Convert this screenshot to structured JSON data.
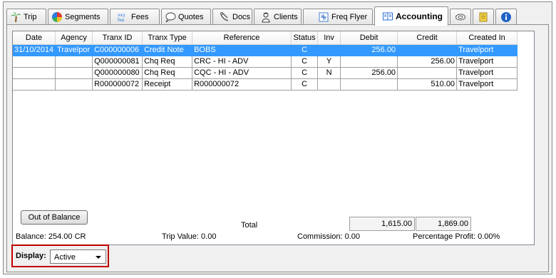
{
  "tabs": [
    {
      "label": "Trip",
      "icon": "palm-tree-icon"
    },
    {
      "label": "Segments",
      "icon": "segments-pie-icon"
    },
    {
      "label": "Fees",
      "icon": "fees-icon"
    },
    {
      "label": "Quotes",
      "icon": "speech-bubble-icon"
    },
    {
      "label": "Docs",
      "icon": "docs-icon"
    },
    {
      "label": "Clients",
      "icon": "clients-icon"
    },
    {
      "label": "Freq Flyer",
      "icon": "frequent-flyer-icon"
    },
    {
      "label": "Accounting",
      "icon": "accounting-icon",
      "active": true
    },
    {
      "label": "",
      "icon": "ticket-icon"
    },
    {
      "label": "",
      "icon": "notepad-icon"
    },
    {
      "label": "",
      "icon": "info-icon"
    }
  ],
  "grid": {
    "columns": [
      "Date",
      "Agency",
      "Tranx ID",
      "Tranx Type",
      "Reference",
      "Status",
      "Inv",
      "Debit",
      "Credit",
      "Created In"
    ],
    "rows": [
      {
        "date": "31/10/2014",
        "agency": "Travelpor",
        "tranx_id": "C000000006",
        "tranx_type": "Credit Note",
        "reference": "BOBS",
        "status": "C",
        "inv": "",
        "debit": "256.00",
        "credit": "",
        "created_in": "Travelport",
        "selected": true
      },
      {
        "date": "",
        "agency": "",
        "tranx_id": "Q000000081",
        "tranx_type": "Chq Req",
        "reference": "CRC - HI - ADV",
        "status": "C",
        "inv": "Y",
        "debit": "",
        "credit": "256.00",
        "created_in": "Travelport"
      },
      {
        "date": "",
        "agency": "",
        "tranx_id": "Q000000080",
        "tranx_type": "Chq Req",
        "reference": "CQC - HI - ADV",
        "status": "C",
        "inv": "N",
        "debit": "256.00",
        "credit": "",
        "created_in": "Travelport"
      },
      {
        "date": "",
        "agency": "",
        "tranx_id": "R000000072",
        "tranx_type": "Receipt",
        "reference": "R000000072",
        "status": "C",
        "inv": "",
        "debit": "",
        "credit": "510.00",
        "created_in": "Travelport"
      }
    ]
  },
  "out_of_balance_label": "Out of Balance",
  "totals": {
    "label": "Total",
    "debit": "1,615.00",
    "credit": "1,869.00"
  },
  "status": {
    "balance": "Balance: 254.00 CR",
    "trip_value": "Trip Value: 0.00",
    "commission": "Commission: 0.00",
    "percentage_profit": "Percentage Profit: 0.00%"
  },
  "display": {
    "label": "Display:",
    "value": "Active"
  },
  "colors": {
    "selection": "#3399ff",
    "highlight_border": "#c00000"
  }
}
